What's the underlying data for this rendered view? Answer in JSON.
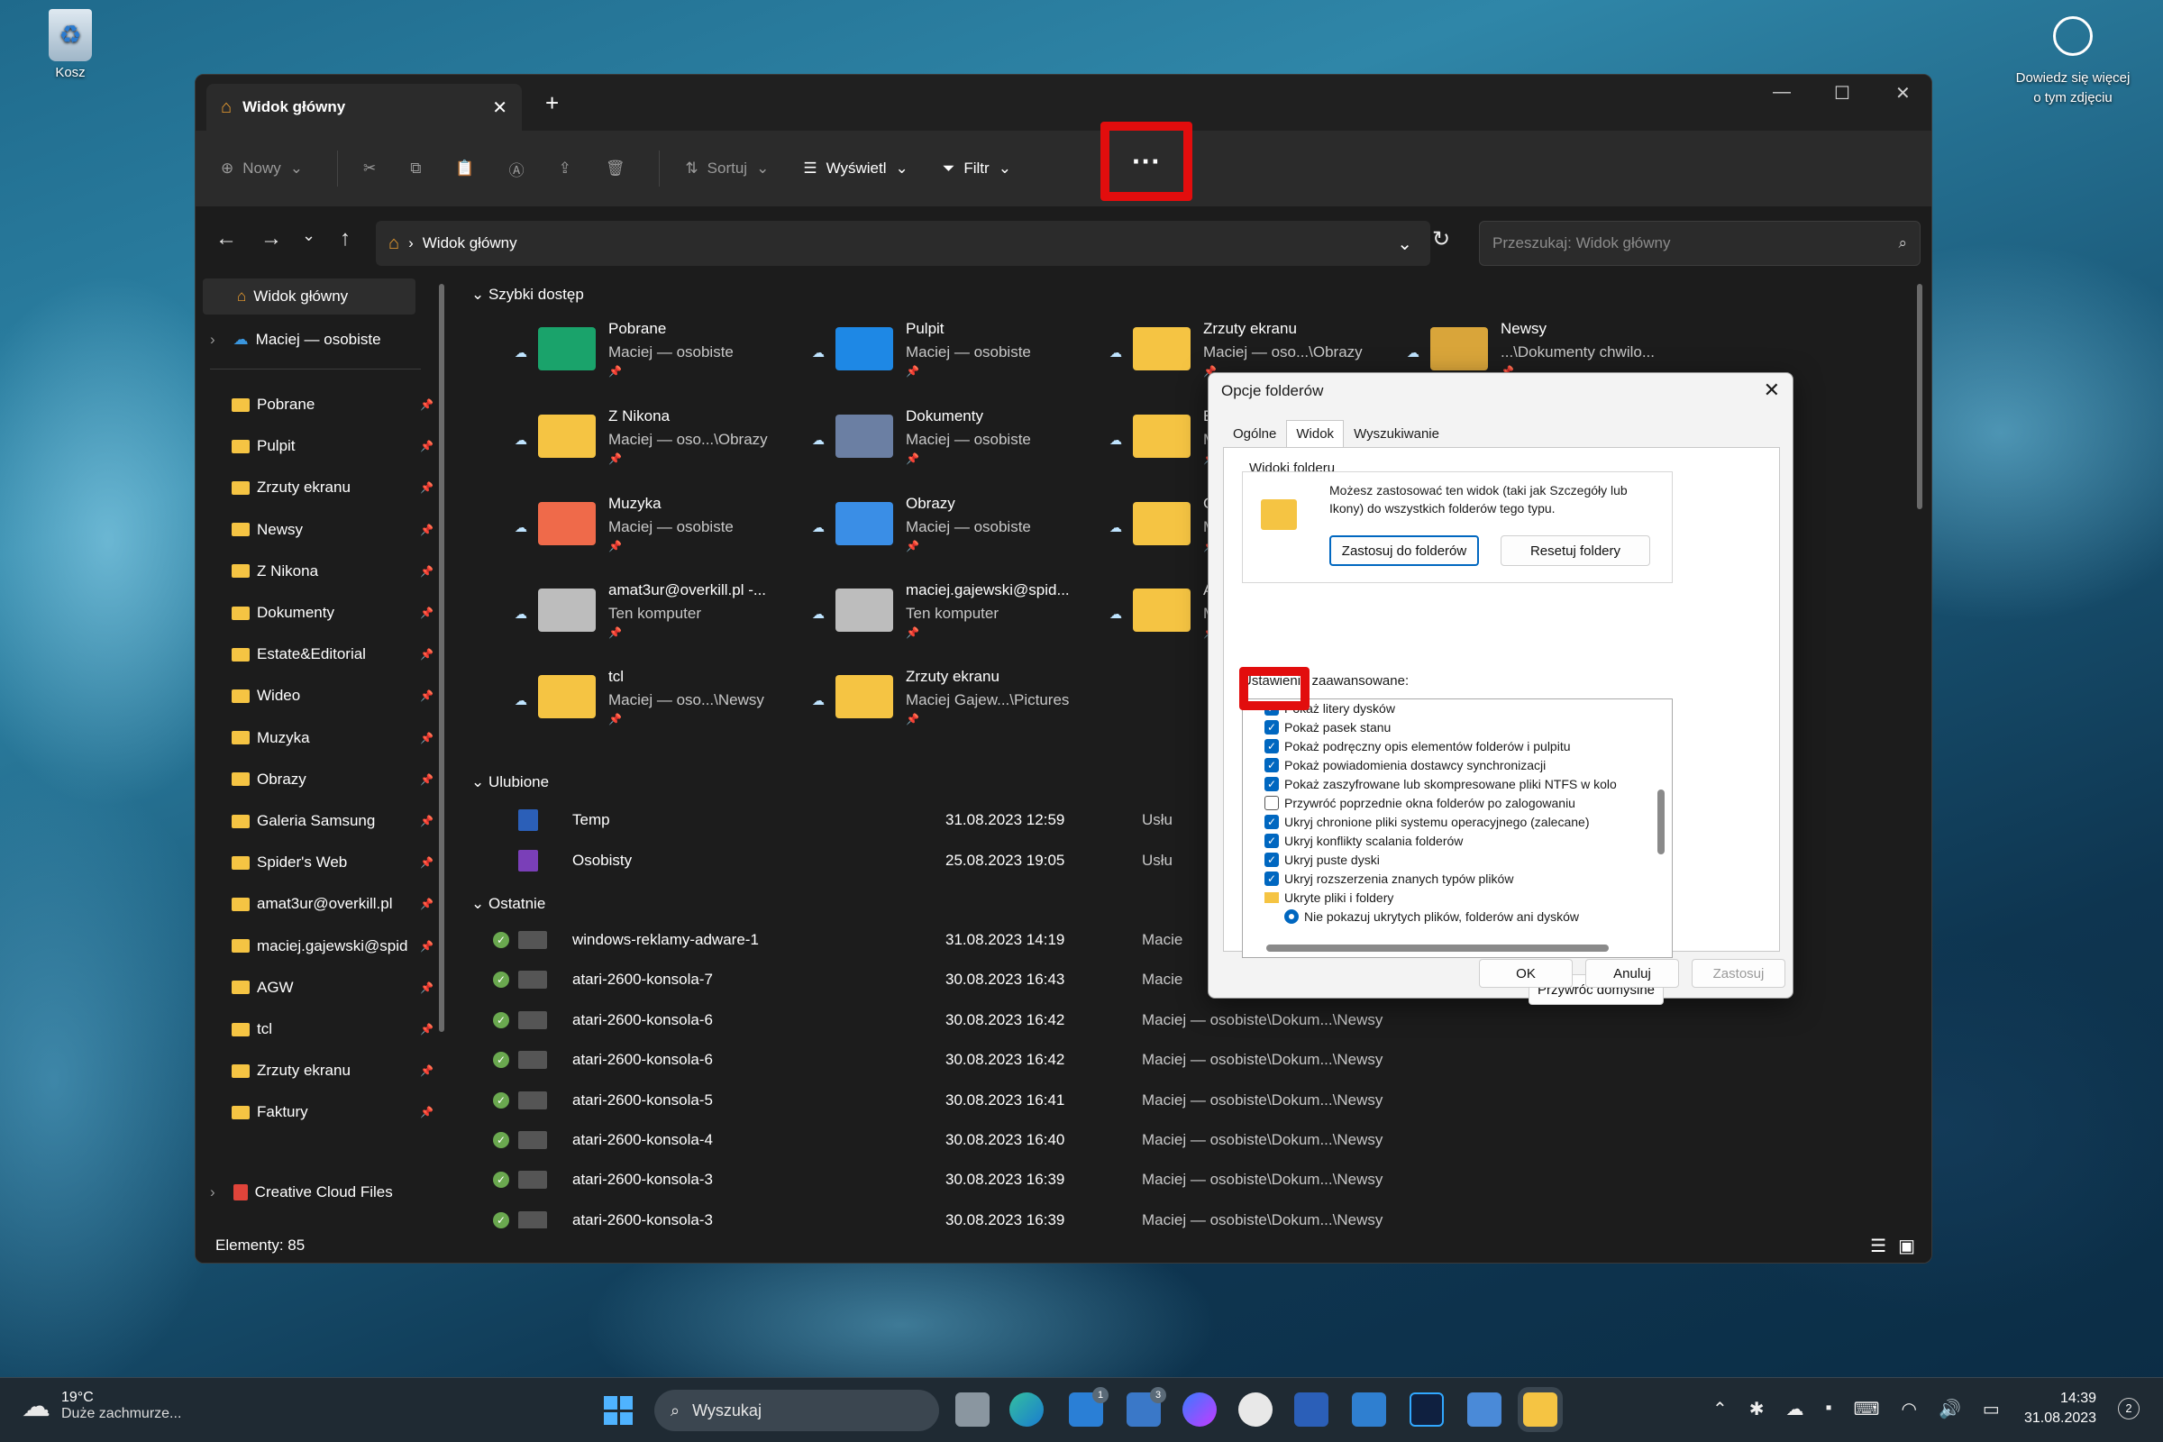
{
  "desktop": {
    "recycle_bin": "Kosz",
    "learn_more": "Dowiedz się więcej",
    "learn_more2": "o tym zdjęciu"
  },
  "window": {
    "tab_title": "Widok główny",
    "tab_close": "✕",
    "new_tab": "+"
  },
  "toolbar": {
    "new": "Nowy",
    "sort": "Sortuj",
    "view": "Wyświetl",
    "filter": "Filtr",
    "more": "···"
  },
  "address": {
    "path": "Widok główny",
    "search_placeholder": "Przeszukaj: Widok główny"
  },
  "sidebar": {
    "home": "Widok główny",
    "onedrive": "Maciej — osobiste",
    "items": [
      "Pobrane",
      "Pulpit",
      "Zrzuty ekranu",
      "Newsy",
      "Z Nikona",
      "Dokumenty",
      "Estate&Editorial",
      "Wideo",
      "Muzyka",
      "Obrazy",
      "Galeria Samsung",
      "Spider's Web",
      "amat3ur@overkill.pl",
      "maciej.gajewski@spid",
      "AGW",
      "tcl",
      "Zrzuty ekranu",
      "Faktury"
    ],
    "creative": "Creative Cloud Files"
  },
  "quick_access": {
    "header": "Szybki dostęp",
    "tiles": [
      {
        "name": "Pobrane",
        "sub": "Maciej — osobiste"
      },
      {
        "name": "Pulpit",
        "sub": "Maciej — osobiste"
      },
      {
        "name": "Zrzuty ekranu",
        "sub": "Maciej — oso...\\Obrazy"
      },
      {
        "name": "Newsy",
        "sub": "...\\Dokumenty chwilo..."
      },
      {
        "name": "Z Nikona",
        "sub": "Maciej — oso...\\Obrazy"
      },
      {
        "name": "Dokumenty",
        "sub": "Maciej — osobiste"
      },
      {
        "name": "Es",
        "sub": "M"
      },
      {
        "name": "Muzyka",
        "sub": "Maciej — osobiste"
      },
      {
        "name": "Obrazy",
        "sub": "Maciej — osobiste"
      },
      {
        "name": "Ga",
        "sub": "M"
      },
      {
        "name": "amat3ur@overkill.pl -...",
        "sub": "Ten komputer"
      },
      {
        "name": "maciej.gajewski@spid...",
        "sub": "Ten komputer"
      },
      {
        "name": "AG",
        "sub": "M"
      },
      {
        "name": "tcl",
        "sub": "Maciej — oso...\\Newsy"
      },
      {
        "name": "Zrzuty ekranu",
        "sub": "Maciej Gajew...\\Pictures"
      }
    ]
  },
  "favorites": {
    "header": "Ulubione",
    "rows": [
      {
        "name": "Temp",
        "date": "31.08.2023 12:59",
        "loc": "Usłu"
      },
      {
        "name": "Osobisty",
        "date": "25.08.2023 19:05",
        "loc": "Usłu"
      }
    ]
  },
  "recent": {
    "header": "Ostatnie",
    "rows": [
      {
        "name": "windows-reklamy-adware-1",
        "date": "31.08.2023 14:19",
        "loc": "Macie"
      },
      {
        "name": "atari-2600-konsola-7",
        "date": "30.08.2023 16:43",
        "loc": "Macie"
      },
      {
        "name": "atari-2600-konsola-6",
        "date": "30.08.2023 16:42",
        "loc": "Maciej — osobiste\\Dokum...\\Newsy"
      },
      {
        "name": "atari-2600-konsola-6",
        "date": "30.08.2023 16:42",
        "loc": "Maciej — osobiste\\Dokum...\\Newsy"
      },
      {
        "name": "atari-2600-konsola-5",
        "date": "30.08.2023 16:41",
        "loc": "Maciej — osobiste\\Dokum...\\Newsy"
      },
      {
        "name": "atari-2600-konsola-4",
        "date": "30.08.2023 16:40",
        "loc": "Maciej — osobiste\\Dokum...\\Newsy"
      },
      {
        "name": "atari-2600-konsola-3",
        "date": "30.08.2023 16:39",
        "loc": "Maciej — osobiste\\Dokum...\\Newsy"
      },
      {
        "name": "atari-2600-konsola-3",
        "date": "30.08.2023 16:39",
        "loc": "Maciej — osobiste\\Dokum...\\Newsy"
      }
    ]
  },
  "status_bar": "Elementy: 85",
  "dialog": {
    "title": "Opcje folderów",
    "tabs": [
      "Ogólne",
      "Widok",
      "Wyszukiwanie"
    ],
    "group_title": "Widoki folderu",
    "group_text": "Możesz zastosować ten widok (taki jak Szczegóły lub Ikony) do wszystkich folderów tego typu.",
    "apply_folders": "Zastosuj do folderów",
    "reset_folders": "Resetuj foldery",
    "advanced_label": "Ustawienia zaawansowane:",
    "options": [
      {
        "label": "Pokaż litery dysków",
        "checked": true
      },
      {
        "label": "Pokaż pasek stanu",
        "checked": true
      },
      {
        "label": "Pokaż podręczny opis elementów folderów i pulpitu",
        "checked": true
      },
      {
        "label": "Pokaż powiadomienia dostawcy synchronizacji",
        "checked": true
      },
      {
        "label": "Pokaż zaszyfrowane lub skompresowane pliki NTFS w kolo",
        "checked": true
      },
      {
        "label": "Przywróć poprzednie okna folderów po zalogowaniu",
        "checked": false
      },
      {
        "label": "Ukryj chronione pliki systemu operacyjnego (zalecane)",
        "checked": true
      },
      {
        "label": "Ukryj konflikty scalania folderów",
        "checked": true
      },
      {
        "label": "Ukryj puste dyski",
        "checked": true
      },
      {
        "label": "Ukryj rozszerzenia znanych typów plików",
        "checked": true
      }
    ],
    "hidden_files_folder": "Ukryte pliki i foldery",
    "radio_option": "Nie pokazuj ukrytych plików, folderów ani dysków",
    "restore_defaults": "Przywróć domyślne",
    "ok": "OK",
    "cancel": "Anuluj",
    "apply": "Zastosuj"
  },
  "taskbar": {
    "temp": "19°C",
    "weather": "Duże zachmurze...",
    "search": "Wyszukaj",
    "time": "14:39",
    "date": "31.08.2023",
    "badge_mail": "1",
    "badge_teams": "3",
    "notif": "2"
  }
}
